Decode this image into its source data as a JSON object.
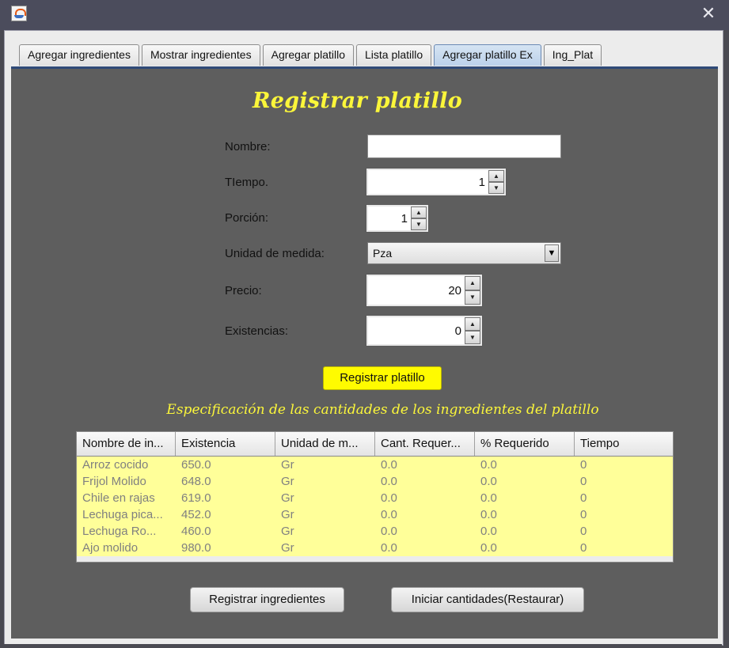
{
  "window": {
    "close_glyph": "✕",
    "icons": {
      "app": "java-cup-icon",
      "close": "close-icon"
    }
  },
  "tabs": [
    {
      "label": "Agregar ingredientes",
      "active": false
    },
    {
      "label": "Mostrar ingredientes",
      "active": false
    },
    {
      "label": "Agregar platillo",
      "active": false
    },
    {
      "label": "Lista platillo",
      "active": false
    },
    {
      "label": "Agregar platillo Ex",
      "active": true
    },
    {
      "label": "Ing_Plat",
      "active": false
    }
  ],
  "form": {
    "title": "Registrar platillo",
    "nombre": {
      "label": "Nombre:",
      "value": ""
    },
    "tiempo": {
      "label": "TIempo.",
      "value": "1"
    },
    "porcion": {
      "label": "Porción:",
      "value": "1"
    },
    "unidad": {
      "label": "Unidad de medida:",
      "selected": "Pza"
    },
    "precio": {
      "label": "Precio:",
      "value": "20"
    },
    "existencias": {
      "label": "Existencias:",
      "value": "0"
    },
    "submit_label": "Registrar platillo"
  },
  "spec": {
    "title": "Especificación de las cantidades de los ingredientes del platillo",
    "columns": [
      "Nombre de in...",
      "Existencia",
      "Unidad de m...",
      "Cant. Requer...",
      "% Requerido",
      "Tiempo"
    ],
    "rows": [
      [
        "Arroz cocido",
        "650.0",
        "Gr",
        "0.0",
        "0.0",
        "0"
      ],
      [
        "Frijol Molido",
        "648.0",
        "Gr",
        "0.0",
        "0.0",
        "0"
      ],
      [
        "Chile en rajas",
        "619.0",
        "Gr",
        "0.0",
        "0.0",
        "0"
      ],
      [
        "Lechuga pica...",
        "452.0",
        "Gr",
        "0.0",
        "0.0",
        "0"
      ],
      [
        "Lechuga Ro...",
        "460.0",
        "Gr",
        "0.0",
        "0.0",
        "0"
      ],
      [
        "Ajo molido",
        "980.0",
        "Gr",
        "0.0",
        "0.0",
        "0"
      ]
    ]
  },
  "buttons": {
    "register_ingredients": "Registrar ingredientes",
    "reset": "Iniciar cantidades(Restaurar)"
  },
  "colors": {
    "title_yellow": "#fbf63a",
    "panel_bg": "#5e5e5e",
    "table_rows": "#ffff99",
    "button_yellow": "#fffb00"
  }
}
